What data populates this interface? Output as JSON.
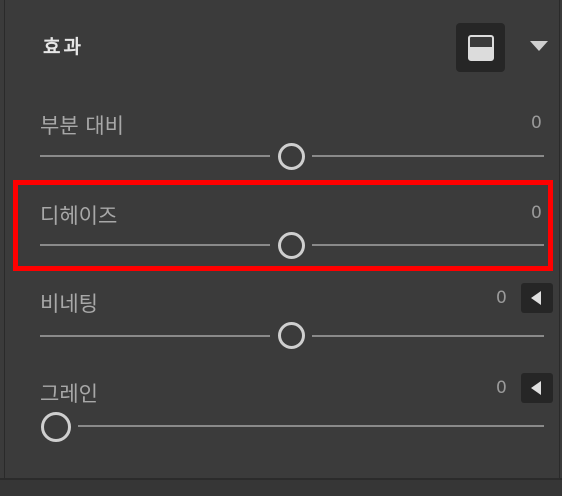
{
  "panel": {
    "title": "효과",
    "preset_icon": "panel-layout-icon",
    "collapse_icon": "triangle-down-icon"
  },
  "sliders": [
    {
      "label": "부분 대비",
      "value": "0",
      "position": 0.5,
      "has_reset": false
    },
    {
      "label": "디헤이즈",
      "value": "0",
      "position": 0.5,
      "has_reset": false,
      "highlighted": true
    },
    {
      "label": "비네팅",
      "value": "0",
      "position": 0.5,
      "has_reset": true
    },
    {
      "label": "그레인",
      "value": "0",
      "position": 0.0,
      "has_reset": true
    }
  ],
  "colors": {
    "background": "#3b3b3b",
    "track": "#8a8a8a",
    "thumb": "#cfcfcf",
    "highlight": "#ff0000"
  }
}
